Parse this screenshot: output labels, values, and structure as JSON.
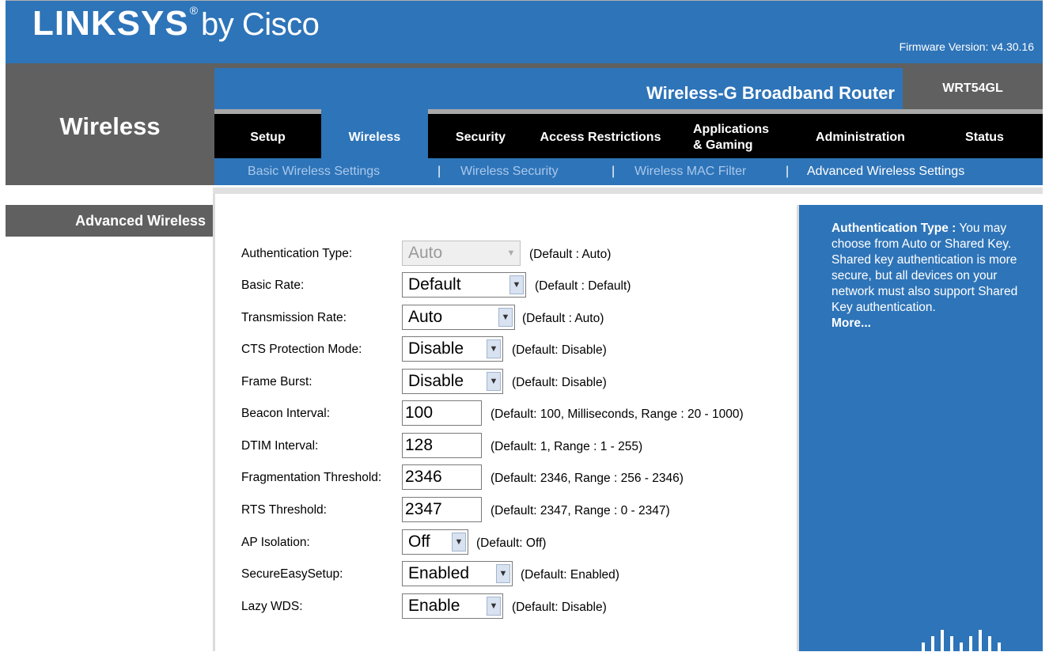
{
  "header": {
    "brand": "LINKSYS",
    "brand_suffix": "by Cisco",
    "firmware": "Firmware Version: v4.30.16"
  },
  "nav": {
    "section_title": "Wireless",
    "product_name": "Wireless-G Broadband Router",
    "model": "WRT54GL",
    "tabs": [
      {
        "label": "Setup",
        "active": false
      },
      {
        "label": "Wireless",
        "active": true
      },
      {
        "label": "Security",
        "active": false
      },
      {
        "label": "Access Restrictions",
        "active": false
      },
      {
        "label": "Applications\n& Gaming",
        "active": false
      },
      {
        "label": "Administration",
        "active": false
      },
      {
        "label": "Status",
        "active": false
      }
    ],
    "subtabs": [
      {
        "label": "Basic Wireless Settings",
        "active": false
      },
      {
        "label": "Wireless Security",
        "active": false
      },
      {
        "label": "Wireless MAC Filter",
        "active": false
      },
      {
        "label": "Advanced Wireless Settings",
        "active": true
      }
    ],
    "separator": "|"
  },
  "page": {
    "left_title": "Advanced Wireless"
  },
  "form": {
    "auth_type": {
      "label": "Authentication Type:",
      "value": "Auto",
      "default": "(Default : Auto)",
      "disabled": true
    },
    "basic_rate": {
      "label": "Basic Rate:",
      "value": "Default",
      "default": "(Default : Default)"
    },
    "tx_rate": {
      "label": "Transmission Rate:",
      "value": "Auto",
      "default": "(Default : Auto)"
    },
    "cts": {
      "label": "CTS Protection Mode:",
      "value": "Disable",
      "default": "(Default: Disable)"
    },
    "frame_burst": {
      "label": "Frame Burst:",
      "value": "Disable",
      "default": "(Default: Disable)"
    },
    "beacon": {
      "label": "Beacon Interval:",
      "value": "100",
      "default": "(Default: 100, Milliseconds, Range : 20 - 1000)"
    },
    "dtim": {
      "label": "DTIM Interval:",
      "value": "128",
      "default": "(Default: 1, Range : 1 - 255)"
    },
    "frag": {
      "label": "Fragmentation Threshold:",
      "value": "2346",
      "default": "(Default: 2346, Range : 256 - 2346)"
    },
    "rts": {
      "label": "RTS Threshold:",
      "value": "2347",
      "default": "(Default: 2347, Range : 0 - 2347)"
    },
    "ap_isolation": {
      "label": "AP Isolation:",
      "value": "Off",
      "default": "(Default: Off)"
    },
    "ses": {
      "label": "SecureEasySetup:",
      "value": "Enabled",
      "default": "(Default: Enabled)"
    },
    "lazy_wds": {
      "label": "Lazy WDS:",
      "value": "Enable",
      "default": "(Default: Disable)"
    }
  },
  "help": {
    "title": "Authentication Type :",
    "body": "You may choose from Auto or Shared Key. Shared key authentication is more secure, but all devices on your network must also support Shared Key authentication.",
    "more": "More..."
  },
  "colors": {
    "brand_blue": "#2e74b8",
    "nav_gray": "#606060",
    "tab_black": "#000000",
    "subtab_inactive": "#a9c8ec"
  },
  "icons": {
    "dropdown": "chevron-down-icon",
    "logo": "cisco-bars-icon"
  }
}
